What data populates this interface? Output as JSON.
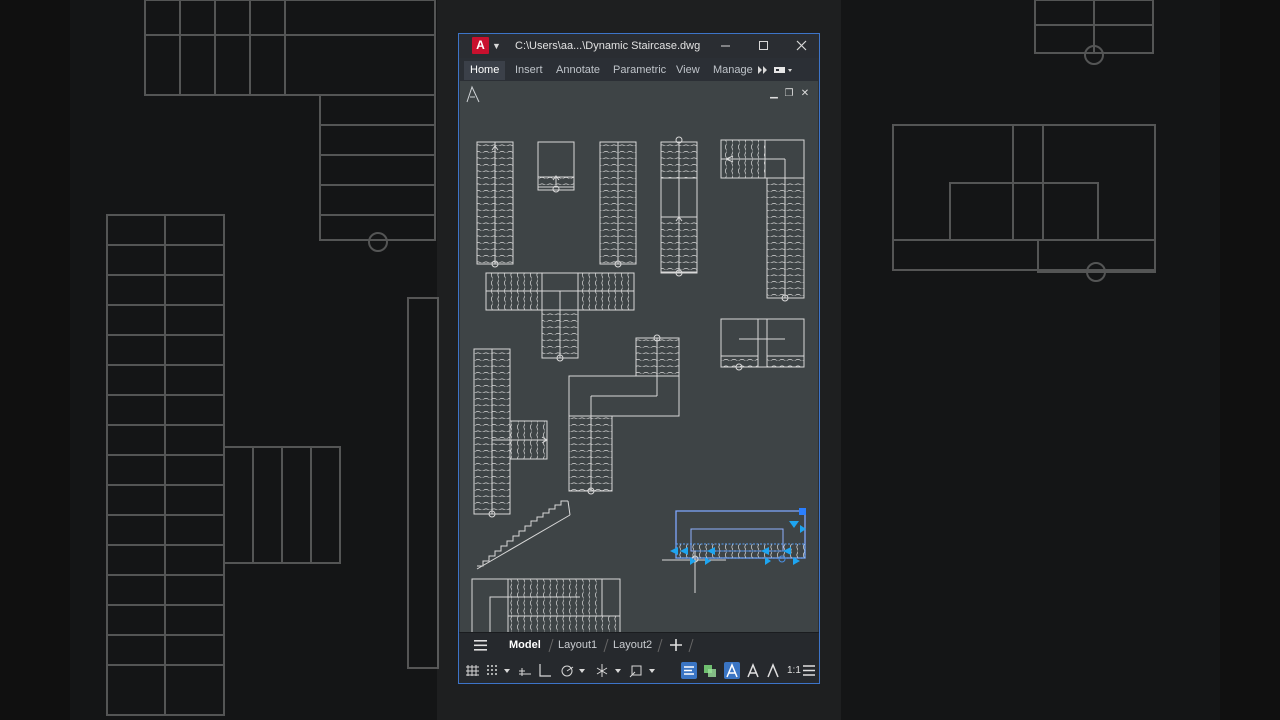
{
  "window": {
    "app_logo": "A",
    "title": "C:\\Users\\aa...\\Dynamic Staircase.dwg",
    "minimize_icon": "minimize-icon",
    "maximize_icon": "maximize-icon",
    "close_icon": "close-icon"
  },
  "ribbon": {
    "tabs": [
      {
        "label": "Home",
        "active": true
      },
      {
        "label": "Insert",
        "active": false
      },
      {
        "label": "Annotate",
        "active": false
      },
      {
        "label": "Parametric",
        "active": false
      },
      {
        "label": "View",
        "active": false
      },
      {
        "label": "Manage",
        "active": false
      }
    ],
    "overflow_icon": "double-chevron-right-icon",
    "workspace_icon": "workspace-switch-icon"
  },
  "layout_tabs": {
    "menu_icon": "hamburger-icon",
    "tabs": [
      {
        "label": "Model",
        "active": true
      },
      {
        "label": "Layout1",
        "active": false
      },
      {
        "label": "Layout2",
        "active": false
      }
    ],
    "add_icon": "plus-icon"
  },
  "status_bar": {
    "icons": [
      "grid-icon",
      "snap-icon",
      "snap-dropdown-icon",
      "infer-constraints-icon",
      "ortho-icon",
      "polar-icon",
      "polar-dropdown-icon",
      "isodraft-icon",
      "isodraft-dropdown-icon",
      "object-snap-icon",
      "object-snap-dropdown-icon",
      "lineweight-icon",
      "transparency-icon",
      "annotation-visibility-icon",
      "annotation-autoscale-icon"
    ],
    "active_icons": [
      "lineweight-icon",
      "annotation-visibility-icon"
    ],
    "scale": "1:1",
    "customize_icon": "customize-menu-icon"
  },
  "colors": {
    "canvas": "#3e4446",
    "geometry": "#dcdcdc",
    "selection": "#4a90e2",
    "grip": "#1ea5f0",
    "window_border": "#3d74c8"
  }
}
